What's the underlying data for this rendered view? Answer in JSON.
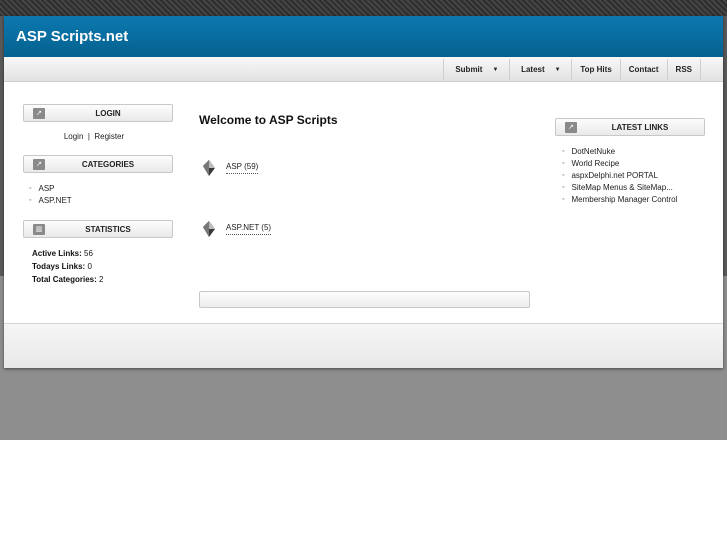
{
  "site": {
    "title": "ASP Scripts.net"
  },
  "nav": {
    "submit": "Submit",
    "latest": "Latest",
    "top_hits": "Top Hits",
    "contact": "Contact",
    "rss": "RSS",
    "caret": "▼"
  },
  "left": {
    "login_title": "LOGIN",
    "login_link": "Login",
    "separator": "|",
    "register_link": "Register",
    "categories_title": "CATEGORIES",
    "categories": [
      "ASP",
      "ASP.NET"
    ],
    "statistics_title": "STATISTICS",
    "stats": [
      {
        "label": "Active Links:",
        "value": "56"
      },
      {
        "label": "Todays Links:",
        "value": "0"
      },
      {
        "label": "Total Categories:",
        "value": "2"
      }
    ]
  },
  "main": {
    "title": "Welcome to ASP Scripts",
    "category_links": [
      "ASP (59)",
      "ASP.NET (5)"
    ]
  },
  "right": {
    "latest_title": "LATEST LINKS",
    "latest_links": [
      "DotNetNuke",
      "World Recipe",
      "aspxDelphi.net PORTAL",
      "SiteMap Menus & SiteMap...",
      "Membership Manager Control"
    ]
  },
  "icons": {
    "arrow": "↗",
    "stats": "▥",
    "bullet": "◦"
  },
  "colors": {
    "header_blue": "#0a6fa3",
    "background_gray": "#8e8e8e"
  }
}
